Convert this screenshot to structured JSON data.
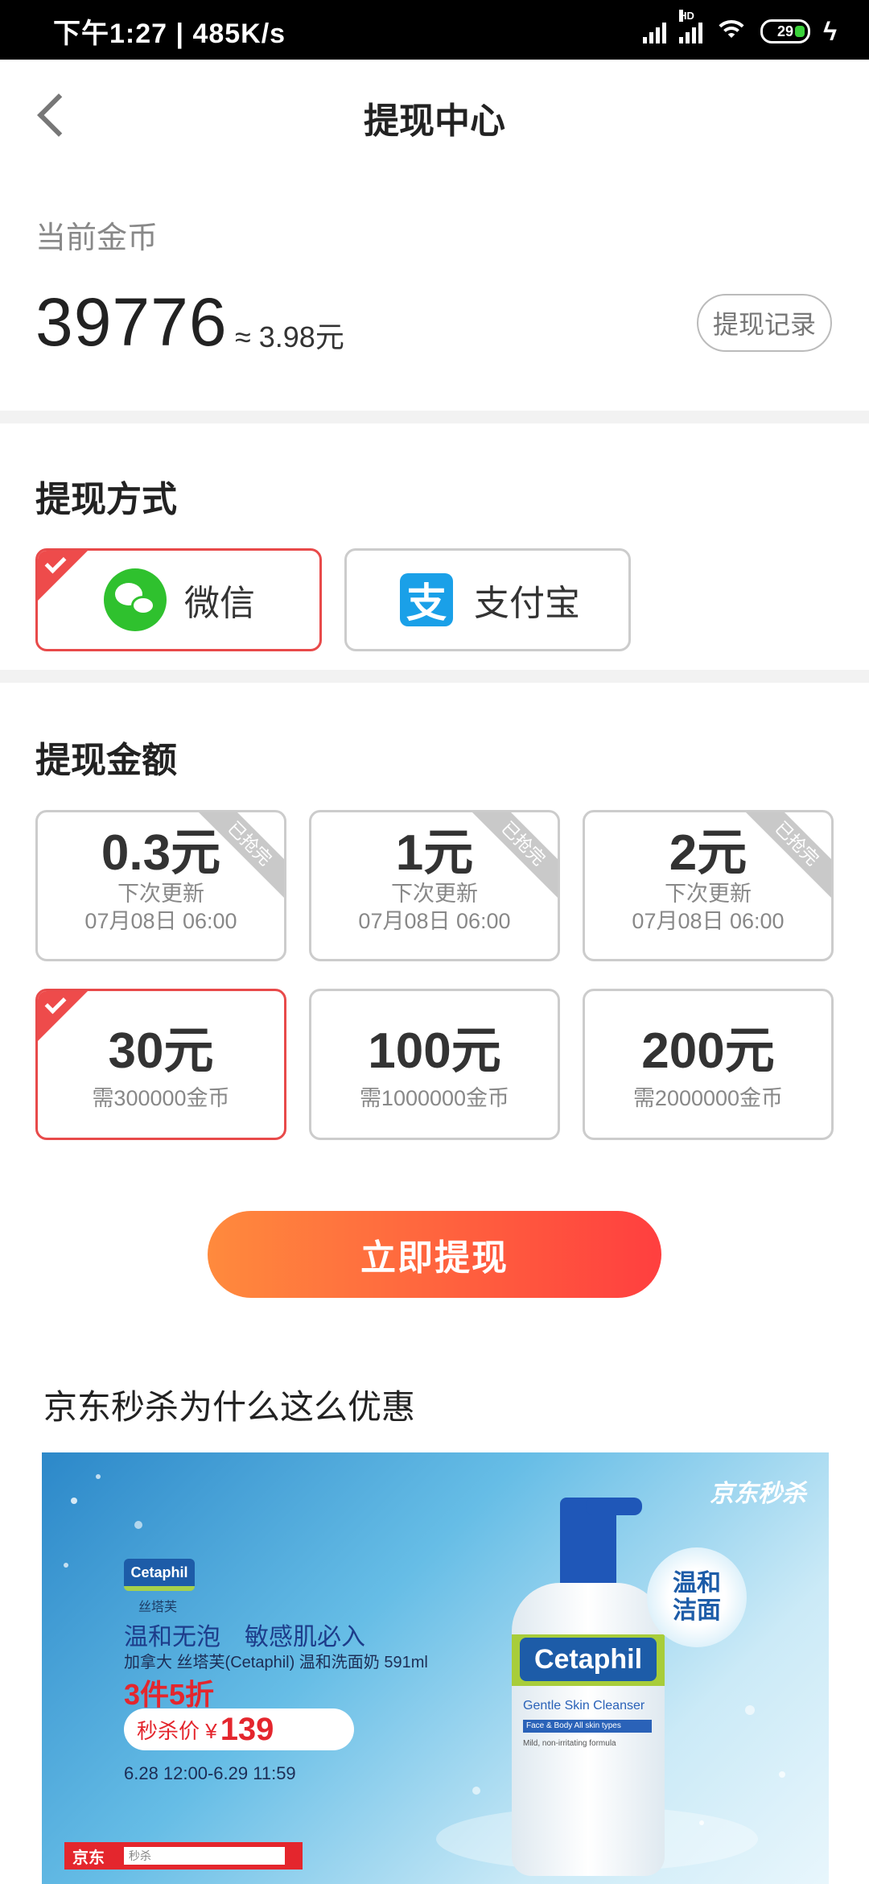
{
  "status_bar": {
    "time": "下午1:27 | 485K/s",
    "network_label": "HD",
    "battery": "29"
  },
  "header": {
    "title": "提现中心"
  },
  "balance": {
    "label": "当前金币",
    "coins": "39776",
    "approx": "≈ 3.98元",
    "record_button": "提现记录"
  },
  "method_section": {
    "title": "提现方式",
    "methods": [
      {
        "label": "微信",
        "selected": true,
        "icon": "wechat-icon"
      },
      {
        "label": "支付宝",
        "selected": false,
        "icon": "alipay-icon",
        "glyph": "支"
      }
    ]
  },
  "amount_section": {
    "title": "提现金额",
    "options": [
      {
        "value": "0.3元",
        "line1": "下次更新",
        "line2": "07月08日 06:00",
        "ribbon": "已抢完",
        "selected": false
      },
      {
        "value": "1元",
        "line1": "下次更新",
        "line2": "07月08日 06:00",
        "ribbon": "已抢完",
        "selected": false
      },
      {
        "value": "2元",
        "line1": "下次更新",
        "line2": "07月08日 06:00",
        "ribbon": "已抢完",
        "selected": false
      },
      {
        "value": "30元",
        "line1": "需300000金币",
        "selected": true
      },
      {
        "value": "100元",
        "line1": "需1000000金币",
        "selected": false
      },
      {
        "value": "200元",
        "line1": "需2000000金币",
        "selected": false
      }
    ]
  },
  "withdraw_button": "立即提现",
  "ad": {
    "title": "京东秒杀为什么这么优惠",
    "brand_mark": "京东秒杀",
    "logo": "Cetaphil",
    "logo_cn": "丝塔芙",
    "headline": "温和无泡　敏感肌必入",
    "product": "加拿大 丝塔芙(Cetaphil) 温和洗面奶 591ml",
    "promo": "3件5折",
    "price_label": "秒杀价 ¥",
    "price": "139",
    "date_range": "6.28 12:00-6.29 11:59",
    "jd_label": "京东",
    "jd_search": "秒杀",
    "bottle_name": "Cetaphil",
    "bottle_sub": "Gentle Skin Cleanser",
    "bottle_tag": "Face & Body   All skin types",
    "bottle_small": "Mild, non-irritating formula",
    "circle_line1": "温和",
    "circle_line2": "洁面",
    "colors": {
      "accent": "#e84a4a",
      "button_start": "#ff8a3d",
      "button_end": "#ff3f3f",
      "price": "#e4262d"
    }
  }
}
